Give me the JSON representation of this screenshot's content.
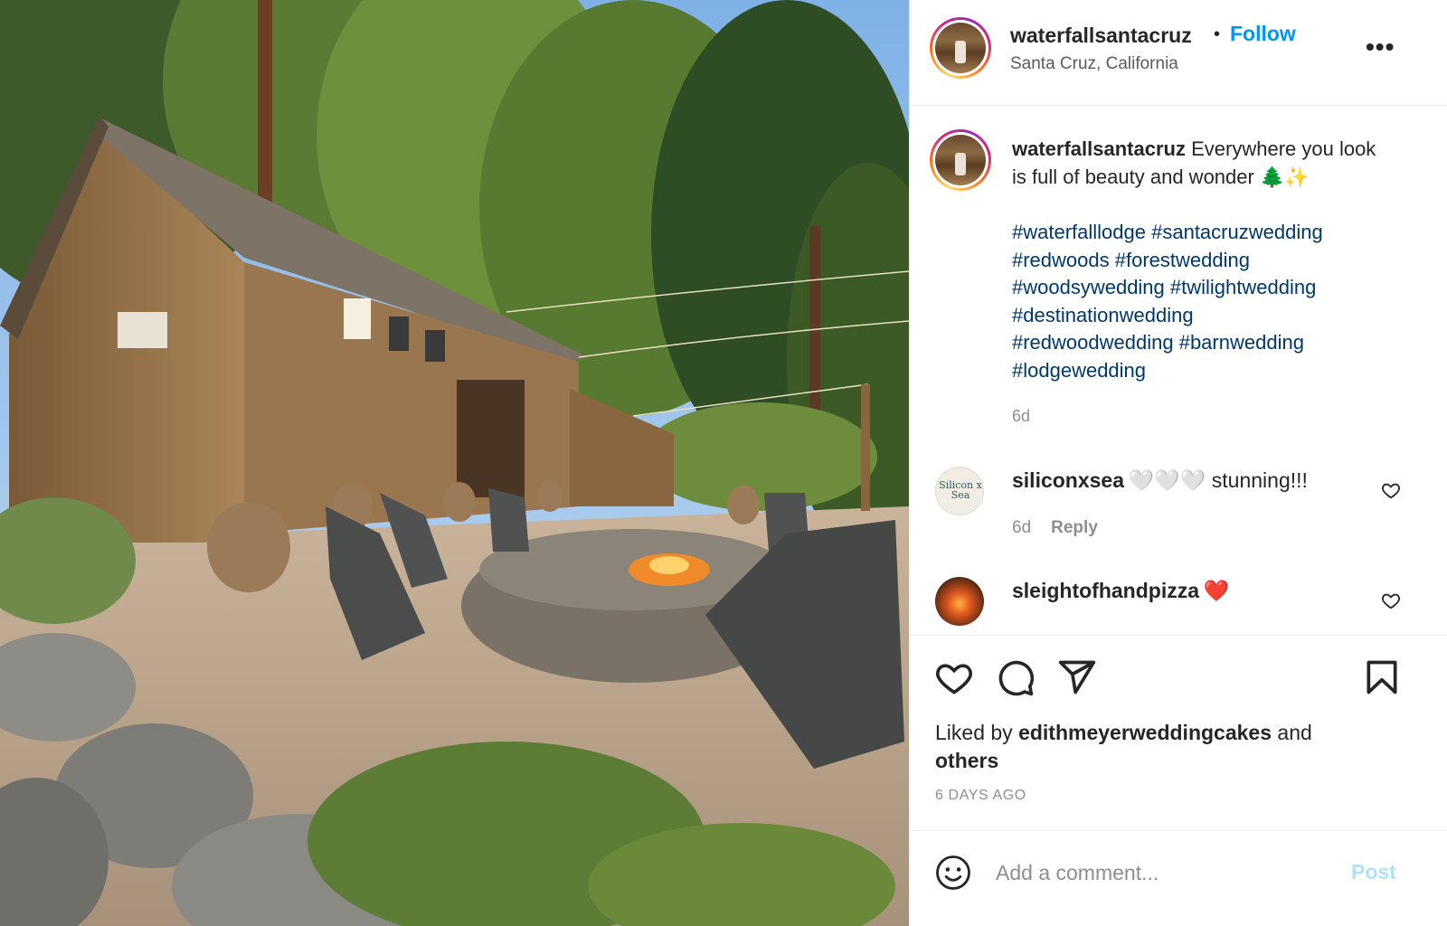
{
  "post": {
    "username": "waterfallsantacruz",
    "separator": "•",
    "follow_label": "Follow",
    "location": "Santa Cruz, California",
    "more_label": "•••",
    "caption_text": "Everywhere you look is full of beauty and wonder 🌲✨",
    "hashtags": [
      "#waterfalllodge",
      "#santacruzwedding",
      "#redwoods",
      "#forestwedding",
      "#woodsywedding",
      "#twilightwedding",
      "#destinationwedding",
      "#redwoodwedding",
      "#barnwedding",
      "#lodgewedding"
    ],
    "caption_time": "6d"
  },
  "comments": [
    {
      "username": "siliconxsea",
      "text": "🤍🤍🤍 stunning!!!",
      "time": "6d",
      "reply_label": "Reply",
      "avatar_text": "Silicon x Sea"
    },
    {
      "username": "sleightofhandpizza",
      "text": "❤️"
    }
  ],
  "actions": {
    "liked_prefix": "Liked by",
    "liked_user": "edithmeyerweddingcakes",
    "liked_and": "and",
    "liked_others": "others",
    "date": "6 DAYS AGO"
  },
  "comment_box": {
    "placeholder": "Add a comment...",
    "post_label": "Post"
  },
  "colors": {
    "link_blue": "#0095f6",
    "hashtag_navy": "#00376b",
    "muted_gray": "#8e8e8e",
    "post_disabled": "#b2dffc"
  },
  "icons": [
    "more-icon",
    "heart-icon",
    "comment-icon",
    "share-icon",
    "bookmark-icon",
    "emoji-icon"
  ]
}
